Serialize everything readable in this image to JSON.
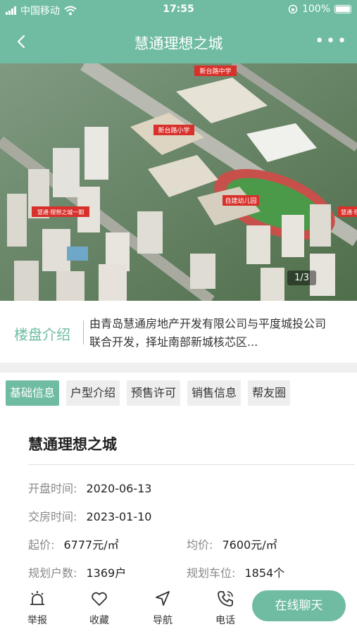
{
  "status_bar": {
    "carrier": "中国移动",
    "time": "17:55",
    "battery_pct": "100%"
  },
  "nav": {
    "title": "慧通理想之城",
    "back_icon": "chevron-left-icon",
    "more_label": "•••"
  },
  "gallery": {
    "counter": "1/3",
    "labels": [
      "新台路中学",
      "新台路小学",
      "自建幼儿园",
      "慧通·理想之城一期",
      "慧通·理想之城"
    ]
  },
  "intro": {
    "label": "楼盘介绍",
    "text": "由青岛慧通房地产开发有限公司与平度城投公司联合开发，择址南部新城核芯区..."
  },
  "tabs": [
    {
      "label": "基础信息",
      "active": true
    },
    {
      "label": "户型介绍",
      "active": false
    },
    {
      "label": "预售许可",
      "active": false
    },
    {
      "label": "销售信息",
      "active": false
    },
    {
      "label": "帮友圈",
      "active": false
    }
  ],
  "info": {
    "title": "慧通理想之城",
    "open_label": "开盘时间:",
    "open_value": "2020-06-13",
    "delivery_label": "交房时间:",
    "delivery_value": "2023-01-10",
    "start_price_label": "起价:",
    "start_price_value": "6777元/㎡",
    "avg_price_label": "均价:",
    "avg_price_value": "7600元/㎡",
    "households_label": "规划户数:",
    "households_value": "1369户",
    "parking_label": "规划车位:",
    "parking_value": "1854个"
  },
  "bottom": {
    "report": "举报",
    "favorite": "收藏",
    "navigate": "导航",
    "phone": "电话",
    "chat": "在线聊天"
  },
  "colors": {
    "accent": "#6fbca3",
    "label_red": "#d8312b"
  }
}
